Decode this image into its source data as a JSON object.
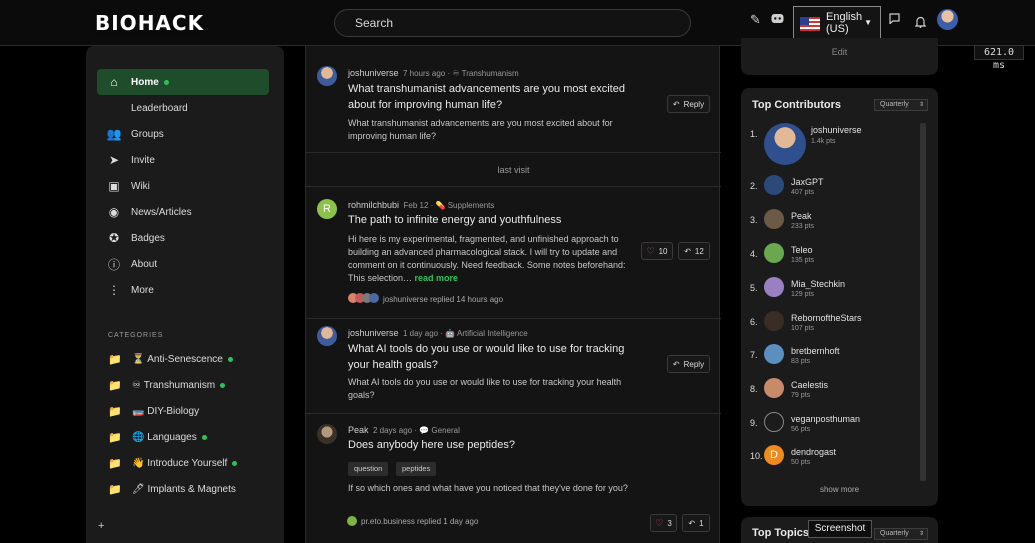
{
  "header": {
    "logo": "BIOHACK",
    "search_placeholder": "Search",
    "language_line1": "English",
    "language_line2": "(US)",
    "perf": "621.0 ms"
  },
  "sidebar": {
    "items": [
      {
        "label": "Home",
        "icon": "home-icon"
      },
      {
        "label": "Leaderboard",
        "icon": "trophy-icon"
      },
      {
        "label": "Groups",
        "icon": "users-icon"
      },
      {
        "label": "Invite",
        "icon": "send-icon"
      },
      {
        "label": "Wiki",
        "icon": "book-icon"
      },
      {
        "label": "News/Articles",
        "icon": "rss-icon"
      },
      {
        "label": "Badges",
        "icon": "badge-icon"
      },
      {
        "label": "About",
        "icon": "info-icon"
      },
      {
        "label": "More",
        "icon": "more-icon"
      }
    ],
    "categories_title": "CATEGORIES",
    "categories": [
      {
        "emoji": "⏳",
        "label": "Anti-Senescence",
        "online": true
      },
      {
        "emoji": "♾",
        "label": "Transhumanism",
        "online": true
      },
      {
        "emoji": "🧫",
        "label": "DIY-Biology",
        "online": false
      },
      {
        "emoji": "🌐",
        "label": "Languages",
        "online": true
      },
      {
        "emoji": "👋",
        "label": "Introduce Yourself",
        "online": true
      },
      {
        "emoji": "🖊",
        "label": "Implants & Magnets",
        "online": false
      }
    ],
    "plus": "+"
  },
  "feed": {
    "last_visit": "last visit",
    "posts": [
      {
        "author": "joshuniverse",
        "time": "7 hours ago",
        "category": "Transhumanism",
        "category_emoji": "♾",
        "title": "What transhumanist advancements are you most excited about for improving human life?",
        "body": "What transhumanist advancements are you most excited about for improving human life?",
        "reply_label": "Reply"
      },
      {
        "author": "rohmilchbubi",
        "time": "Feb 12",
        "category": "Supplements",
        "category_emoji": "💊",
        "initial": "R",
        "title": "The path to infinite energy and youthfulness",
        "body": "Hi here is my experimental, fragmented, and unfinished approach to building an advanced pharmacological stack. I will try to update and comment on it continuously. Need feedback. Some notes beforehand: This selection…",
        "read_more": "read more",
        "likes": "10",
        "replies": "12",
        "last_reply": "joshuniverse replied 14 hours ago"
      },
      {
        "author": "joshuniverse",
        "time": "1 day ago",
        "category": "Artificial Intelligence",
        "category_emoji": "🤖",
        "title": "What AI tools do you use or would like to use for tracking your health goals?",
        "body": "What AI tools do you use or would like to use for tracking your health goals?",
        "reply_label": "Reply"
      },
      {
        "author": "Peak",
        "time": "2 days ago",
        "category": "General",
        "category_emoji": "💬",
        "title": "Does anybody here use peptides?",
        "tags": [
          "question",
          "peptides"
        ],
        "body": "If so which ones and what have you noticed that they've done for you?",
        "likes": "3",
        "replies": "1",
        "last_reply": "pr.eto.business replied 1 day ago"
      }
    ]
  },
  "right": {
    "edit_label": "Edit",
    "contributors_title": "Top Contributors",
    "period": "Quarterly",
    "contributors": [
      {
        "rank": "1.",
        "name": "joshuniverse",
        "pts": "1.4k pts"
      },
      {
        "rank": "2.",
        "name": "JaxGPT",
        "pts": "407 pts"
      },
      {
        "rank": "3.",
        "name": "Peak",
        "pts": "233 pts"
      },
      {
        "rank": "4.",
        "name": "Teleo",
        "pts": "135 pts"
      },
      {
        "rank": "5.",
        "name": "Mia_Stechkin",
        "pts": "129 pts"
      },
      {
        "rank": "6.",
        "name": "RebornoftheStars",
        "pts": "107 pts"
      },
      {
        "rank": "7.",
        "name": "bretbernhoft",
        "pts": "83 pts"
      },
      {
        "rank": "8.",
        "name": "Caelestis",
        "pts": "79 pts"
      },
      {
        "rank": "9.",
        "name": "veganposthuman",
        "pts": "56 pts"
      },
      {
        "rank": "10.",
        "name": "dendrogast",
        "pts": "50 pts",
        "initial": "D"
      }
    ],
    "show_more": "show more",
    "topics_title": "Top Topics",
    "topics_period": "Quarterly",
    "tooltip": "Screenshot"
  },
  "colors": {
    "accent": "#2ec35a",
    "active_nav": "#1f4d2c",
    "heart": "#e0556a"
  }
}
